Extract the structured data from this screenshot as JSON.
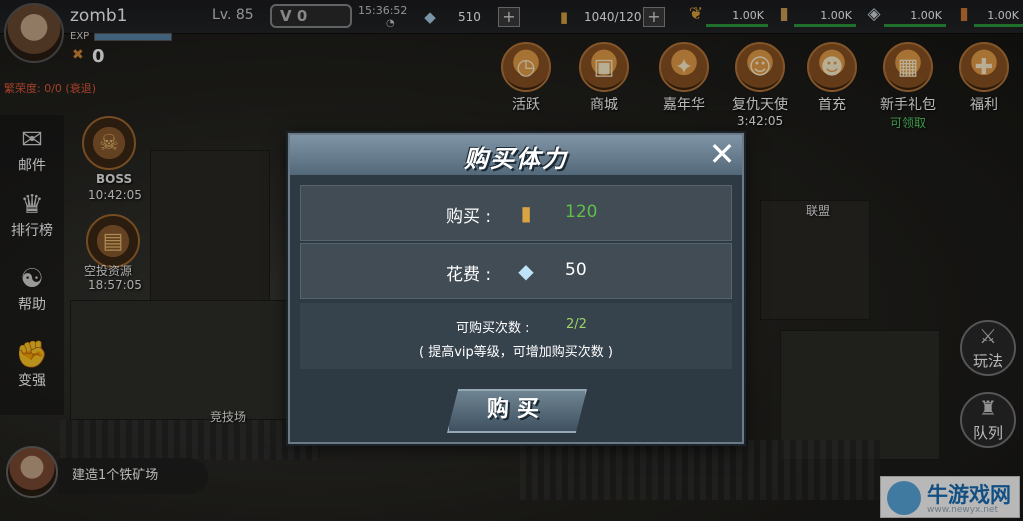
{
  "player": {
    "name": "zomb1",
    "exp_label": "EXP",
    "power": "0",
    "prosperity": "繁荣度: 0/0 (衰退)",
    "level": "Lv. 85",
    "vip": "V 0"
  },
  "status": {
    "time": "15:36:52"
  },
  "resources": {
    "diamonds": "510",
    "stamina": "1040/120",
    "res1": "1.00K",
    "res2": "1.00K",
    "res3": "1.00K",
    "res4": "1.00K"
  },
  "features": [
    {
      "label": "活跃",
      "sub": ""
    },
    {
      "label": "商城",
      "sub": ""
    },
    {
      "label": "嘉年华",
      "sub": ""
    },
    {
      "label": "复仇天使",
      "sub": "3:42:05"
    },
    {
      "label": "首充",
      "sub": ""
    },
    {
      "label": "新手礼包",
      "sub": "可领取"
    },
    {
      "label": "福利",
      "sub": ""
    }
  ],
  "side_menu": [
    {
      "label": "邮件"
    },
    {
      "label": "排行榜"
    },
    {
      "label": "帮助"
    },
    {
      "label": "变强"
    }
  ],
  "map": {
    "boss_label": "BOSS",
    "boss_timer": "10:42:05",
    "airdrop_label": "空投资源",
    "airdrop_timer": "18:57:05",
    "arena": "竞技场",
    "alliance": "联盟"
  },
  "right_side": [
    {
      "label": "玩法"
    },
    {
      "label": "队列"
    }
  ],
  "task": {
    "text": "建造1个铁矿场"
  },
  "dialog": {
    "title": "购买体力",
    "buy_label": "购买 :",
    "buy_amount": "120",
    "cost_label": "花费 :",
    "cost_amount": "50",
    "count_label": "可购买次数 :",
    "count_value": "2/2",
    "hint": "( 提高vip等级，可增加购买次数 )",
    "button": "购买"
  },
  "watermark": {
    "name": "牛游戏网",
    "url": "www.newyx.net"
  },
  "colors": {
    "green_value": "#5fbf4a",
    "count_green": "#9dd36a",
    "dialog_bg": "#2d3a44",
    "header": "#6b8293"
  }
}
